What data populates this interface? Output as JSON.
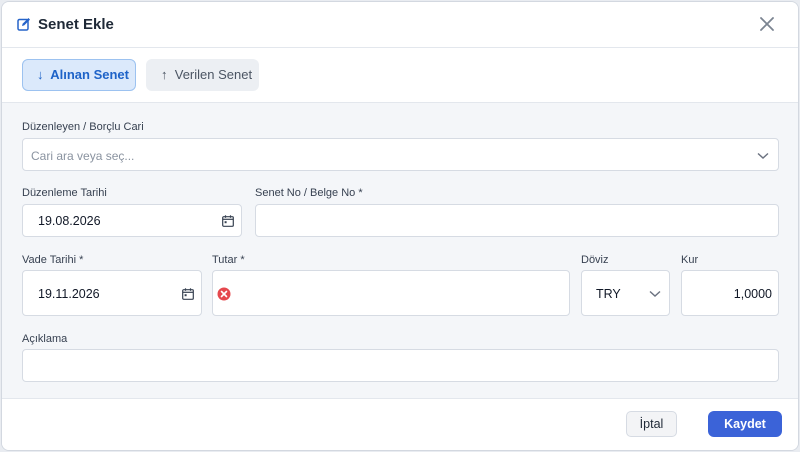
{
  "dialog": {
    "title": "Senet Ekle",
    "title_icon": "edit-icon",
    "close_icon": "close-icon"
  },
  "tabs": [
    {
      "arrow": "↓",
      "label": "Alınan Senet",
      "active": true
    },
    {
      "arrow": "↑",
      "label": "Verilen Senet",
      "active": false
    }
  ],
  "form": {
    "cari": {
      "label": "Düzenleyen / Borçlu Cari",
      "placeholder": "Cari ara veya seç..."
    },
    "duzenleme_tarihi": {
      "label": "Düzenleme Tarihi",
      "value": "19.08.2026"
    },
    "senet_no": {
      "label": "Senet No / Belge No *",
      "value": ""
    },
    "vade_tarihi": {
      "label": "Vade Tarihi *",
      "value": "19.11.2026"
    },
    "tutar": {
      "label": "Tutar *",
      "value": "",
      "status": "error-icon"
    },
    "doviz": {
      "label": "Döviz",
      "value": "TRY"
    },
    "kur": {
      "label": "Kur",
      "value": "1,0000"
    },
    "aciklama": {
      "label": "Açıklama",
      "value": ""
    }
  },
  "footer": {
    "cancel_label": "İptal",
    "save_label": "Kaydet"
  },
  "colors": {
    "primary": "#3b63d8",
    "active_tab_bg": "#dbe9fb",
    "active_tab_text": "#1e63c8",
    "error": "#e5484d"
  }
}
